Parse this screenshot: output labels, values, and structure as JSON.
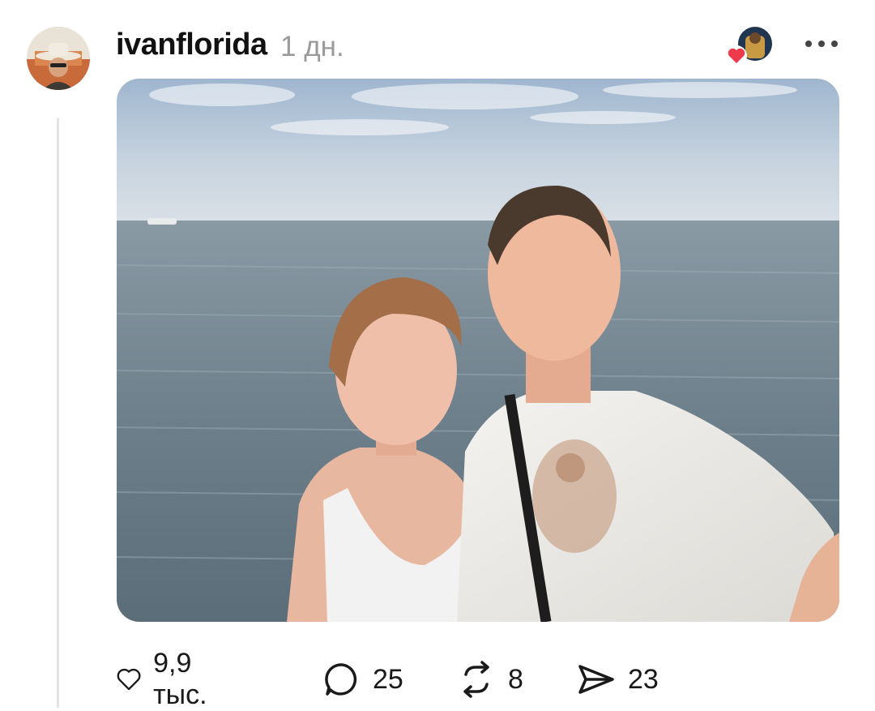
{
  "post": {
    "author": "ivanflorida",
    "time_ago": "1 дн.",
    "author_avatar_icon": "cowboy-hat-avatar",
    "liked_by_avatar_icon": "heart-badge-avatar",
    "menu_icon": "more-horizontal-icon",
    "image_description_icon": "beach-selfie-photo"
  },
  "actions": {
    "likes": "9,9 тыс.",
    "replies": "25",
    "reposts": "8",
    "shares": "23"
  },
  "colors": {
    "heart_badge": "#ee3a4a",
    "secondary_text": "#9a9a9a",
    "thread_line": "#e4e4e4"
  }
}
